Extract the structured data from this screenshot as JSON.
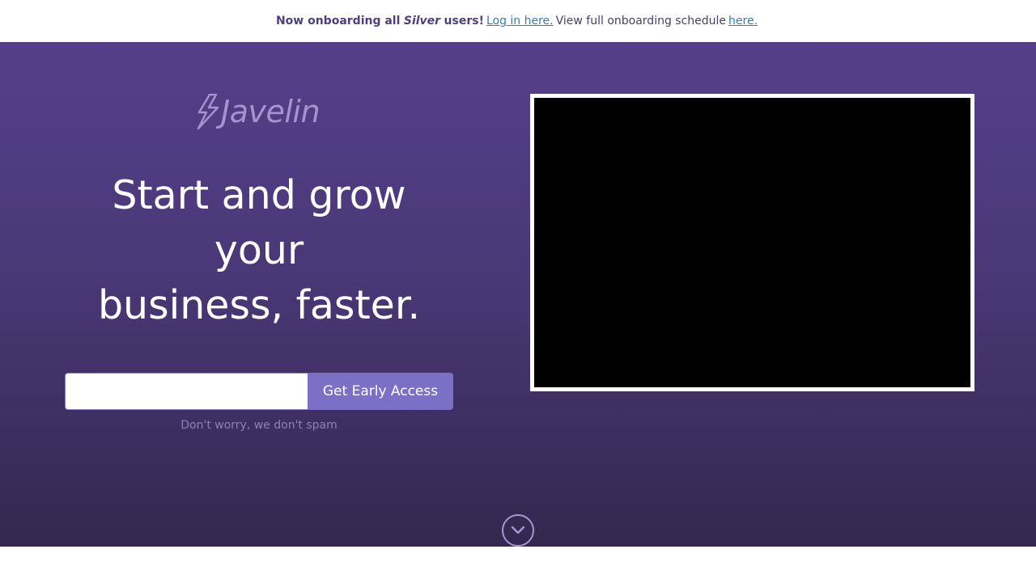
{
  "announcement": {
    "prefix": "Now onboarding all",
    "tier": "Silver",
    "suffix": "users!",
    "login_link": "Log in here.",
    "schedule_text": "View full onboarding schedule",
    "schedule_link": "here."
  },
  "brand": {
    "name": "Javelin",
    "color": "#a793d0"
  },
  "hero": {
    "headline_line1": "Start and grow",
    "headline_line2": "your",
    "headline_line3": "business, faster.",
    "email_placeholder": "",
    "cta_label": "Get Early Access",
    "note": "Don't worry, we don't spam"
  },
  "colors": {
    "hero_top": "#563f8a",
    "hero_bottom": "#33284f",
    "cta": "#7b6fc6",
    "link": "#3a7bb0"
  },
  "icons": {
    "scroll": "chevron-down-icon",
    "logo_mark": "lightning-bolt-icon"
  }
}
